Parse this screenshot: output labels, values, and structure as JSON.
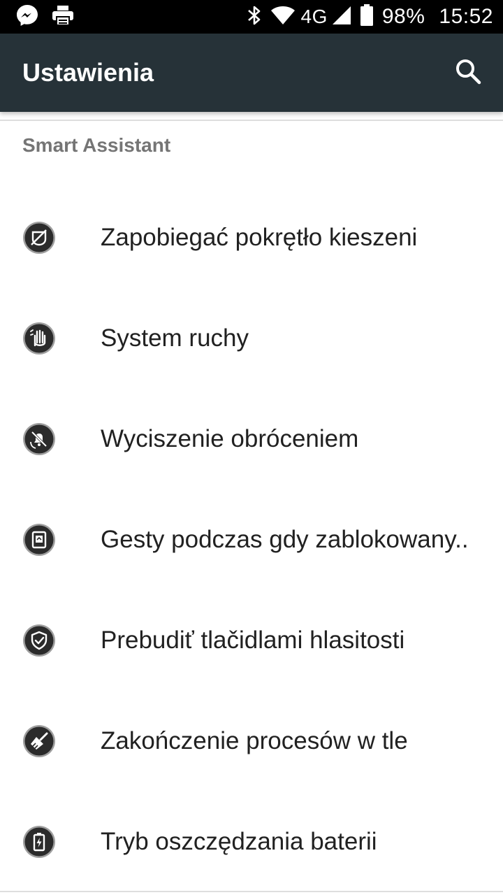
{
  "status_bar": {
    "network": "4G",
    "battery": "98%",
    "time": "15:52",
    "icons": [
      "messenger-icon",
      "printer-icon",
      "bluetooth-icon",
      "wifi-icon",
      "signal-icon",
      "battery-icon"
    ]
  },
  "toolbar": {
    "title": "Ustawienia",
    "search_icon": "search-icon",
    "background": "#263238"
  },
  "section": {
    "title": "Smart Assistant"
  },
  "items": [
    {
      "label": "Zapobiegać pokrętło kieszeni",
      "icon": "pocket-mode-icon"
    },
    {
      "label": "System ruchy",
      "icon": "motion-hand-icon"
    },
    {
      "label": "Wyciszenie obróceniem",
      "icon": "flip-mute-icon"
    },
    {
      "label": "Gesty podczas gdy zablokowany..",
      "icon": "lock-gesture-icon"
    },
    {
      "label": "Prebudiť tlačidlami hlasitosti",
      "icon": "shield-icon"
    },
    {
      "label": "Zakończenie procesów w tle",
      "icon": "broom-icon"
    },
    {
      "label": "Tryb oszczędzania baterii",
      "icon": "battery-saver-icon"
    }
  ]
}
